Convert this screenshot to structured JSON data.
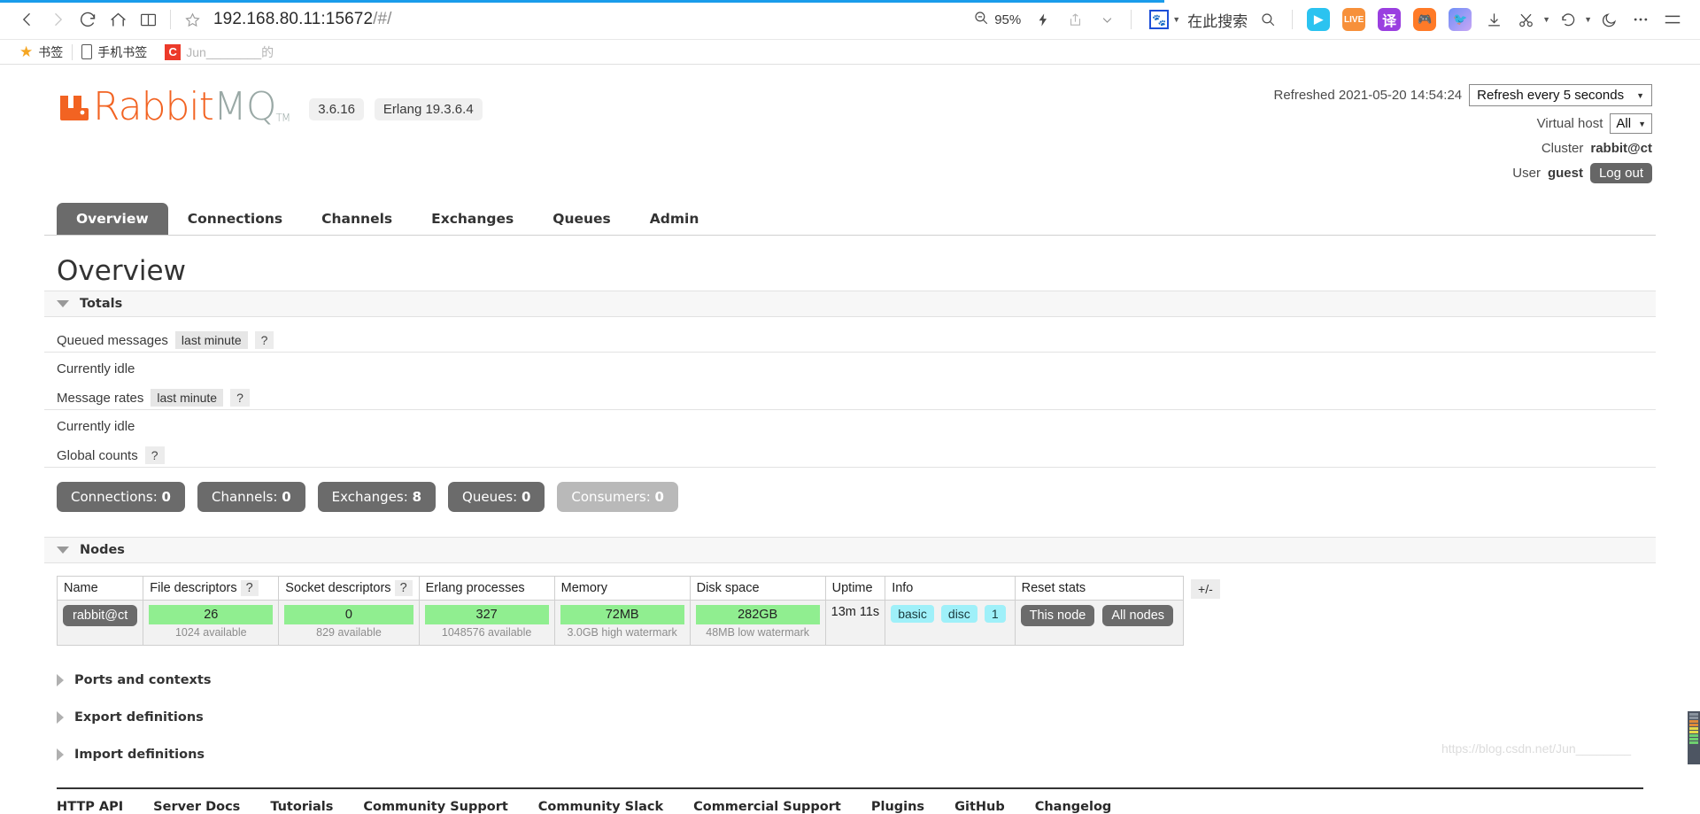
{
  "browser": {
    "url_host": "192.168.80.11:15672",
    "url_path": "/#/",
    "zoom_level": "95%",
    "search_placeholder": "在此搜索",
    "nav": {
      "back": "back-icon",
      "forward": "forward-icon",
      "reload": "reload-icon",
      "home": "home-icon",
      "reader": "reader-icon",
      "bookmark_star": "star-icon"
    },
    "bookmarks": [
      {
        "label": "书签",
        "icon": "star-icon"
      },
      {
        "label": "手机书签",
        "icon": "phone-icon"
      },
      {
        "label": "Jun________的",
        "icon": "csdn-icon"
      }
    ]
  },
  "header": {
    "logo_rabbit": "Rabbit",
    "logo_mq": "MQ",
    "logo_tm": "TM",
    "version": "3.6.16",
    "erlang": "Erlang 19.3.6.4",
    "refreshed_label": "Refreshed 2021-05-20 14:54:24",
    "refresh_select": "Refresh every 5 seconds",
    "vhost_label": "Virtual host",
    "vhost_value": "All",
    "cluster_label": "Cluster",
    "cluster_value": "rabbit@ct",
    "user_label": "User",
    "user_value": "guest",
    "logout_label": "Log out"
  },
  "tabs": [
    {
      "label": "Overview",
      "active": true
    },
    {
      "label": "Connections",
      "active": false
    },
    {
      "label": "Channels",
      "active": false
    },
    {
      "label": "Exchanges",
      "active": false
    },
    {
      "label": "Queues",
      "active": false
    },
    {
      "label": "Admin",
      "active": false
    }
  ],
  "main": {
    "page_title": "Overview",
    "totals_section": "Totals",
    "queued_messages_label": "Queued messages",
    "queued_messages_period": "last minute",
    "queued_messages_help": "?",
    "queued_idle": "Currently idle",
    "message_rates_label": "Message rates",
    "message_rates_period": "last minute",
    "message_rates_help": "?",
    "rates_idle": "Currently idle",
    "global_counts_label": "Global counts",
    "global_counts_help": "?",
    "counts": [
      {
        "label": "Connections:",
        "value": "0",
        "muted": false
      },
      {
        "label": "Channels:",
        "value": "0",
        "muted": false
      },
      {
        "label": "Exchanges:",
        "value": "8",
        "muted": false
      },
      {
        "label": "Queues:",
        "value": "0",
        "muted": false
      },
      {
        "label": "Consumers:",
        "value": "0",
        "muted": true
      }
    ],
    "nodes_section": "Nodes",
    "nodes_table": {
      "columns": [
        {
          "label": "Name",
          "help": ""
        },
        {
          "label": "File descriptors",
          "help": "?"
        },
        {
          "label": "Socket descriptors",
          "help": "?"
        },
        {
          "label": "Erlang processes",
          "help": ""
        },
        {
          "label": "Memory",
          "help": ""
        },
        {
          "label": "Disk space",
          "help": ""
        },
        {
          "label": "Uptime",
          "help": ""
        },
        {
          "label": "Info",
          "help": ""
        },
        {
          "label": "Reset stats",
          "help": ""
        }
      ],
      "plus_minus": "+/-",
      "row": {
        "name": "rabbit@ct",
        "file_descriptors": "26",
        "file_descriptors_sub": "1024 available",
        "socket_descriptors": "0",
        "socket_descriptors_sub": "829 available",
        "erlang_processes": "327",
        "erlang_processes_sub": "1048576 available",
        "memory": "72MB",
        "memory_sub": "3.0GB high watermark",
        "disk_space": "282GB",
        "disk_space_sub": "48MB low watermark",
        "uptime": "13m 11s",
        "info_chips": [
          "basic",
          "disc",
          "1"
        ],
        "reset_this": "This node",
        "reset_all": "All nodes"
      }
    },
    "collapsed_sections": [
      "Ports and contexts",
      "Export definitions",
      "Import definitions"
    ]
  },
  "footer_links": [
    "HTTP API",
    "Server Docs",
    "Tutorials",
    "Community Support",
    "Community Slack",
    "Commercial Support",
    "Plugins",
    "GitHub",
    "Changelog"
  ],
  "watermark": "https://blog.csdn.net/Jun________",
  "colors": {
    "rabbit_orange": "#f26322",
    "dark_button": "#6b6b6b",
    "green_bar": "#90ee90",
    "info_chip": "#9ff0f9",
    "progress_blue": "#1a9ceb"
  }
}
